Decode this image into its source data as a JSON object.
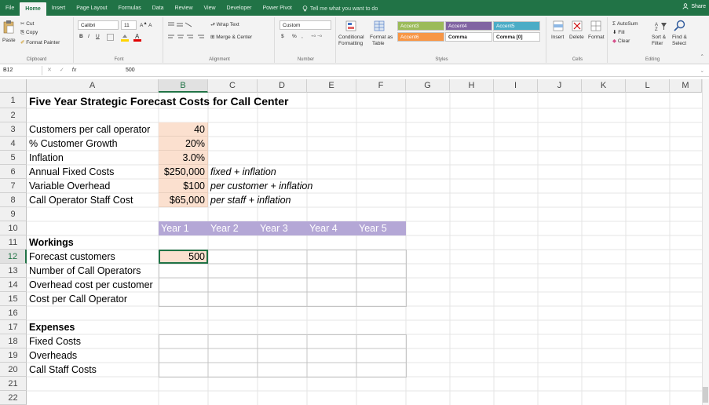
{
  "tabs": [
    "File",
    "Home",
    "Insert",
    "Page Layout",
    "Formulas",
    "Data",
    "Review",
    "View",
    "Developer",
    "Power Pivot"
  ],
  "active_tab": "Home",
  "tell_me": "Tell me what you want to do",
  "share": "Share",
  "ribbon": {
    "clipboard": {
      "paste": "Paste",
      "cut": "Cut",
      "copy": "Copy",
      "format_painter": "Format Painter",
      "label": "Clipboard"
    },
    "font": {
      "name": "Calibri",
      "size": "11",
      "bold": "B",
      "italic": "I",
      "underline": "U",
      "label": "Font"
    },
    "alignment": {
      "wrap": "Wrap Text",
      "merge": "Merge & Center",
      "label": "Alignment"
    },
    "number": {
      "format": "Custom",
      "currency": "$",
      "percent": "%",
      "comma": ",",
      "label": "Number"
    },
    "styles": {
      "conditional": "Conditional",
      "conditional2": "Formatting",
      "format_as": "Format as",
      "format_as2": "Table",
      "cells": [
        "Accent3",
        "Accent4",
        "Accent5",
        "Accent6",
        "Comma",
        "Comma [0]"
      ],
      "label": "Styles"
    },
    "cells": {
      "insert": "Insert",
      "delete": "Delete",
      "format": "Format",
      "label": "Cells"
    },
    "editing": {
      "autosum": "AutoSum",
      "fill": "Fill",
      "clear": "Clear",
      "sort": "Sort &",
      "sort2": "Filter",
      "find": "Find &",
      "find2": "Select",
      "label": "Editing"
    },
    "colors": {
      "accent3": "#9bbb59",
      "accent4": "#8064a2",
      "accent5": "#4bacc6",
      "accent6": "#f79646"
    }
  },
  "formula_bar": {
    "name_box": "B12",
    "fx": "fx",
    "value": "500"
  },
  "columns": [
    "A",
    "B",
    "C",
    "D",
    "E",
    "F",
    "G",
    "H",
    "I",
    "J",
    "K",
    "L",
    "M"
  ],
  "rows": [
    "1",
    "2",
    "3",
    "4",
    "5",
    "6",
    "7",
    "8",
    "9",
    "10",
    "11",
    "12",
    "13",
    "14",
    "15",
    "16",
    "17",
    "18",
    "19",
    "20",
    "21",
    "22"
  ],
  "sheet": {
    "title": "Five Year Strategic Forecast Costs for Call Center",
    "inputs": [
      {
        "label": "Customers per call operator",
        "value": "40",
        "note": ""
      },
      {
        "label": "% Customer Growth",
        "value": "20%",
        "note": ""
      },
      {
        "label": "Inflation",
        "value": "3.0%",
        "note": ""
      },
      {
        "label": "Annual Fixed Costs",
        "value": "$250,000",
        "note": "fixed + inflation"
      },
      {
        "label": "Variable Overhead",
        "value": "$100",
        "note": "per customer + inflation"
      },
      {
        "label": "Call Operator Staff Cost",
        "value": "$65,000",
        "note": "per staff + inflation"
      }
    ],
    "years": [
      "Year 1",
      "Year 2",
      "Year 3",
      "Year 4",
      "Year 5"
    ],
    "workings_heading": "Workings",
    "workings": [
      "Forecast customers",
      "Number of Call Operators",
      "Overhead cost per customer",
      "Cost per Call Operator"
    ],
    "forecast_customers_y1": "500",
    "expenses_heading": "Expenses",
    "expenses": [
      "Fixed Costs",
      "Overheads",
      "Call Staff Costs"
    ]
  },
  "colors": {
    "excel_green": "#217346",
    "input_fill": "#fbe0cf",
    "year_header_fill": "#b4a7d6"
  }
}
